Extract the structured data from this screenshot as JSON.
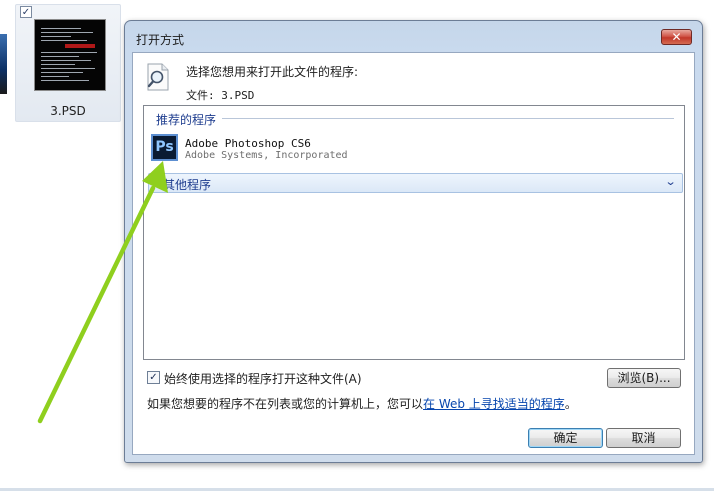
{
  "explorer": {
    "file_name": "3.PSD",
    "tile_checked": "✓"
  },
  "dialog": {
    "title": "打开方式",
    "close_glyph": "✕",
    "prompt": "选择您想用来打开此文件的程序:",
    "file_line": "文件: 3.PSD",
    "recommended_header": "推荐的程序",
    "app": {
      "icon_text": "Ps",
      "name": "Adobe Photoshop CS6",
      "publisher": "Adobe Systems, Incorporated"
    },
    "other_programs": "其他程序",
    "always_use_label": "始终使用选择的程序打开这种文件(A)",
    "always_use_checked": "✓",
    "browse_label": "浏览(B)...",
    "hint_prefix": "如果您想要的程序不在列表或您的计算机上，您可以",
    "hint_link": "在 Web 上寻找适当的程序",
    "hint_suffix": "。",
    "ok_label": "确定",
    "cancel_label": "取消"
  },
  "icons": [
    "checkbox-icon",
    "close-icon",
    "document-search-icon",
    "photoshop-icon",
    "chevron-down-icon",
    "arrow-annotation"
  ],
  "colors": {
    "arrow": "#8fcf1e",
    "link": "#0645ad",
    "section_heading": "#1e3d8f",
    "close_button": "#c2382a"
  }
}
